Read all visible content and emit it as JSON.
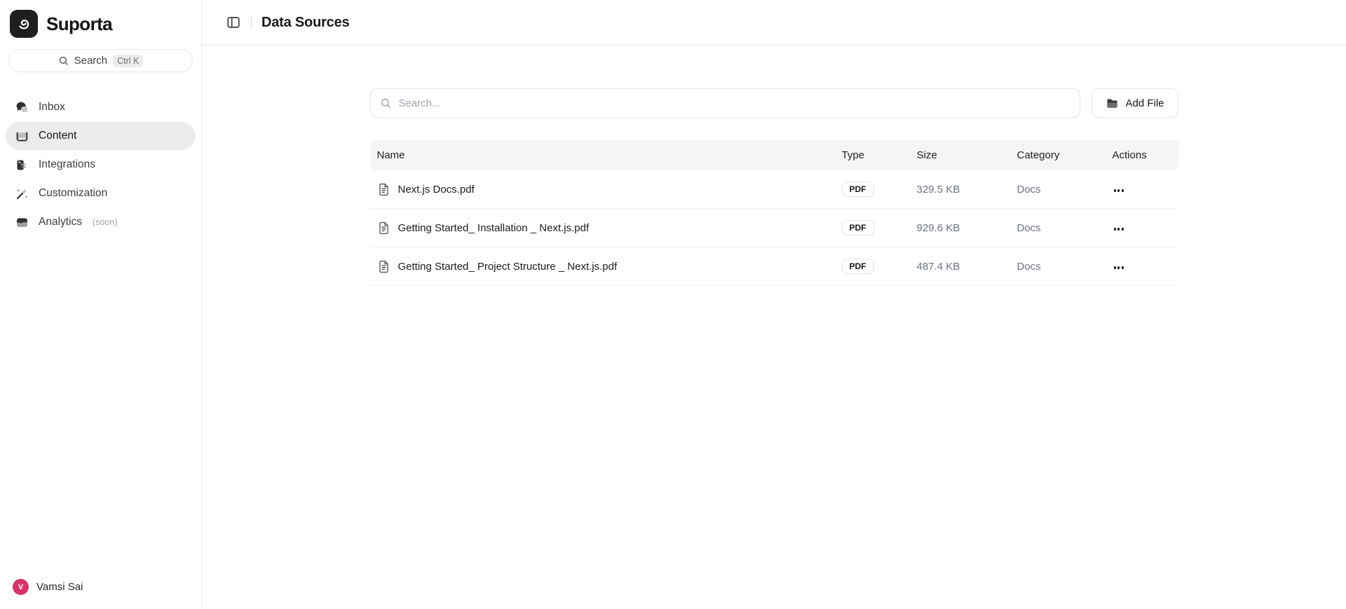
{
  "app": {
    "name": "Suporta"
  },
  "colors": {
    "avatar": "#d6336c",
    "logo_bg": "#1f1f1f",
    "table_header_bg": "#f5f5f5",
    "border": "#e5e5e5",
    "active_item_bg": "#ececec"
  },
  "sidebar": {
    "search": {
      "label": "Search",
      "shortcut": "Ctrl K"
    },
    "items": [
      {
        "label": "Inbox",
        "icon": "inbox-icon",
        "active": false
      },
      {
        "label": "Content",
        "icon": "content-icon",
        "active": true
      },
      {
        "label": "Integrations",
        "icon": "integrations-icon",
        "active": false
      },
      {
        "label": "Customization",
        "icon": "customization-icon",
        "active": false
      },
      {
        "label": "Analytics",
        "suffix": "(soon)",
        "icon": "analytics-icon",
        "active": false
      }
    ],
    "user": {
      "name": "Vamsi Sai",
      "avatar_initial": "V"
    }
  },
  "header": {
    "title": "Data Sources"
  },
  "main": {
    "search_placeholder": "Search...",
    "add_file_label": "Add File",
    "table": {
      "columns": [
        "Name",
        "Type",
        "Size",
        "Category",
        "Actions"
      ],
      "rows": [
        {
          "name": "Next.js Docs.pdf",
          "type": "PDF",
          "size": "329.5 KB",
          "category": "Docs"
        },
        {
          "name": "Getting Started_ Installation _ Next.js.pdf",
          "type": "PDF",
          "size": "929.6 KB",
          "category": "Docs"
        },
        {
          "name": "Getting Started_ Project Structure _ Next.js.pdf",
          "type": "PDF",
          "size": "487.4 KB",
          "category": "Docs"
        }
      ]
    }
  }
}
